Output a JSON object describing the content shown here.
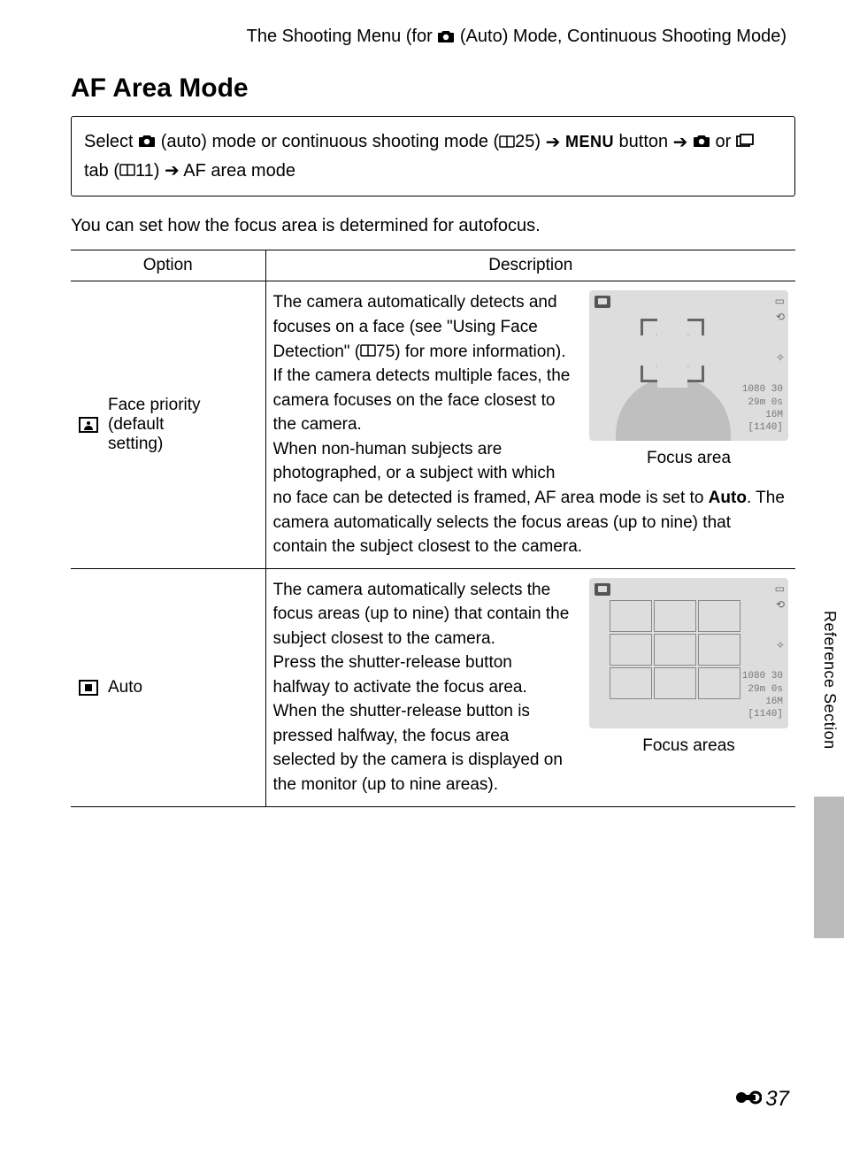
{
  "header": {
    "prefix": "The Shooting Menu (for ",
    "mode_label": " (Auto) Mode, Continuous Shooting Mode)"
  },
  "title": "AF Area Mode",
  "nav": {
    "p1": "Select ",
    "p2": " (auto) mode or continuous shooting mode (",
    "ref1": "25) ",
    "menu_word": "MENU",
    "p3": " button ",
    "p4": " or ",
    "p5": " tab (",
    "ref2": "11) ",
    "p6": " AF area mode"
  },
  "intro": "You can set how the focus area is determined for autofocus.",
  "table": {
    "col_option": "Option",
    "col_description": "Description",
    "rows": [
      {
        "option_l1": "Face priority",
        "option_l2": "(default",
        "option_l3": "setting)",
        "desc_a": "The camera automatically detects and focuses on a face (see \"Using Face Detection\" (",
        "desc_a_ref": "75) for more information).",
        "desc_b": "If the camera detects multiple faces, the camera focuses on the face closest to the camera.",
        "desc_c1": "When non-human subjects are photographed, or a subject with which no face can be detected is framed, AF area mode is set to ",
        "desc_c_bold": "Auto",
        "desc_c2": ". The camera automatically selects the focus areas (up to nine) that contain the subject closest to the camera.",
        "caption": "Focus area",
        "readout1": "1080 30",
        "readout2": "29m 0s",
        "readout3": "16M",
        "readout4": "[1140]"
      },
      {
        "option": "Auto",
        "desc_a": "The camera automatically selects the focus areas (up to nine) that contain the subject closest to the camera.",
        "desc_b": "Press the shutter-release button halfway to activate the focus area. When the shutter-release button is pressed halfway, the focus area selected by the camera is displayed on the monitor (up to nine areas).",
        "caption": "Focus areas",
        "readout1": "1080 30",
        "readout2": "29m 0s",
        "readout3": "16M",
        "readout4": "[1140]"
      }
    ]
  },
  "side_label": "Reference Section",
  "page_number": "37"
}
